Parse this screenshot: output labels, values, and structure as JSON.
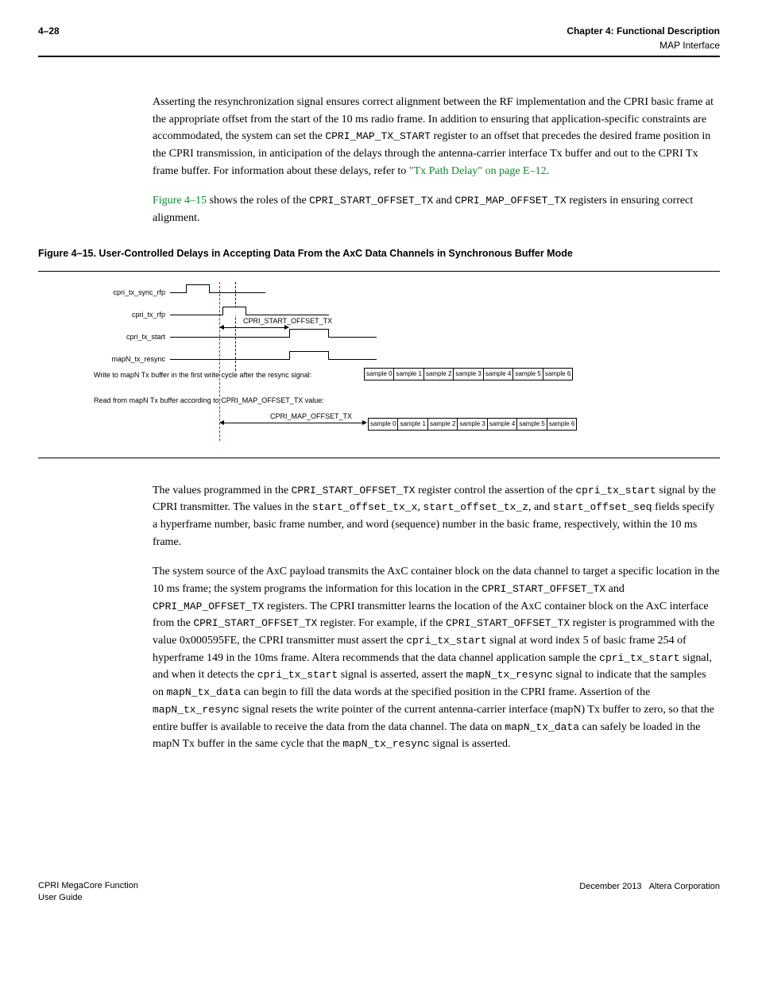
{
  "header": {
    "page_num": "4–28",
    "chapter": "Chapter 4:  Functional Description",
    "section": "MAP Interface"
  },
  "para1": {
    "t1": "Asserting the resynchronization signal ensures correct alignment between the RF implementation and the CPRI basic frame at the appropriate offset from the start of the 10 ms radio frame. In addition to ensuring that application-specific constraints are accommodated, the system can set the ",
    "reg1": "CPRI_MAP_TX_START",
    "t2": " register to an offset that precedes the desired frame position in the CPRI transmission, in anticipation of the delays through the antenna-carrier interface Tx buffer and out to the CPRI Tx frame buffer. For information about these delays, refer to ",
    "link": "\"Tx Path Delay\" on page E–12",
    "t3": "."
  },
  "para2": {
    "link": "Figure 4–15",
    "t1": " shows the roles of the ",
    "reg1": "CPRI_START_OFFSET_TX",
    "t2": " and ",
    "reg2": "CPRI_MAP_OFFSET_TX",
    "t3": " registers in ensuring correct alignment."
  },
  "figure": {
    "caption": "Figure 4–15.  User-Controlled Delays in Accepting Data From the AxC Data Channels in Synchronous Buffer Mode",
    "sig1": "cpri_tx_sync_rfp",
    "sig2": "cpri_tx_rfp",
    "sig3": "cpri_tx_start",
    "sig4": "mapN_tx_resync",
    "off1": "CPRI_START_OFFSET_TX",
    "off2": "CPRI_MAP_OFFSET_TX",
    "row1text": "Write to mapN Tx buffer in the first write cycle after the resync signal:",
    "row2text": "Read from mapN Tx buffer according to CPRI_MAP_OFFSET_TX value:",
    "samples": [
      "sample 0",
      "sample 1",
      "sample 2",
      "sample 3",
      "sample 4",
      "sample 5",
      "sample 6"
    ]
  },
  "para3": {
    "t1": "The values programmed in the ",
    "reg1": "CPRI_START_OFFSET_TX",
    "t2": " register control the assertion of the ",
    "sig1": "cpri_tx_start",
    "t3": " signal by the CPRI transmitter. The values in the ",
    "f1": "start_offset_tx_x",
    "t4": ", ",
    "f2": "start_offset_tx_z",
    "t5": ", and ",
    "f3": "start_offset_seq",
    "t6": " fields specify a hyperframe number, basic frame number, and word (sequence) number in the basic frame, respectively, within the 10 ms frame."
  },
  "para4": {
    "t1": "The system source of the AxC payload transmits the AxC container block on the data channel to target a specific location in the 10 ms frame; the system programs the information for this location in the ",
    "reg1": "CPRI_START_OFFSET_TX",
    "t2": " and ",
    "reg2": "CPRI_MAP_OFFSET_TX",
    "t3": " registers. The CPRI transmitter learns the location of the AxC container block on the AxC interface from the ",
    "reg3": "CPRI_START_OFFSET_TX",
    "t4": " register. For example, if the ",
    "reg4": "CPRI_START_OFFSET_TX",
    "t5": " register is programmed with the value 0x000595FE, the CPRI transmitter must assert the ",
    "sig1": "cpri_tx_start",
    "t6": " signal at word index 5 of basic frame 254 of hyperframe 149 in the 10ms frame. Altera recommends that the data channel application sample the ",
    "sig2": "cpri_tx_start",
    "t7": " signal, and when it detects the ",
    "sig3": "cpri_tx_start",
    "t8": " signal is asserted, assert the ",
    "sig4": "mapN_tx_resync",
    "t9": " signal to indicate that the samples on ",
    "sig5": "mapN_tx_data",
    "t10": " can begin to fill the data words at the specified position in the CPRI frame. Assertion of the ",
    "sig6": "mapN_tx_resync",
    "t11": " signal resets the write pointer of the current antenna-carrier interface (mapN) Tx buffer to zero, so that the entire buffer is available to receive the data from the data channel. The data on ",
    "sig7": "mapN_tx_data",
    "t12": " can safely be loaded in the mapN Tx buffer in the same cycle that the ",
    "sig8": "mapN_tx_resync",
    "t13": " signal is asserted."
  },
  "footer": {
    "doc": "CPRI MegaCore Function",
    "guide": "User Guide",
    "date": "December 2013",
    "corp": "Altera Corporation"
  }
}
